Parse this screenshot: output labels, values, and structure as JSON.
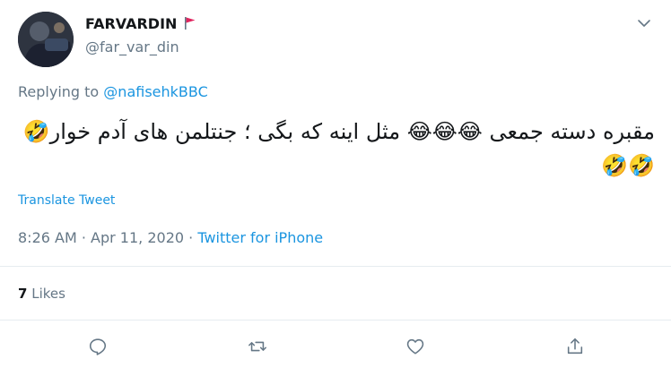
{
  "user": {
    "display_name": "FARVARDIN",
    "handle": "@far_var_din"
  },
  "reply": {
    "prefix": "Replying to ",
    "mention": "@nafisehkBBC"
  },
  "tweet": {
    "text": "مقبره دسته جمعی 😂😂😂 مثل اینه که بگی ؛ جنتلمن های آدم خوار🤣🤣🤣"
  },
  "translate_label": "Translate Tweet",
  "meta": {
    "time": "8:26 AM",
    "date": "Apr 11, 2020",
    "separator": " · ",
    "source": "Twitter for iPhone"
  },
  "stats": {
    "likes_count": "7",
    "likes_label": " Likes"
  },
  "icons": {
    "caret": "chevron-down-icon",
    "reply": "reply-icon",
    "retweet": "retweet-icon",
    "like": "heart-icon",
    "share": "share-icon"
  },
  "colors": {
    "accent": "#1b95e0",
    "secondary_text": "#657786",
    "divider": "#e6ecf0",
    "flag": "#e0245e"
  }
}
